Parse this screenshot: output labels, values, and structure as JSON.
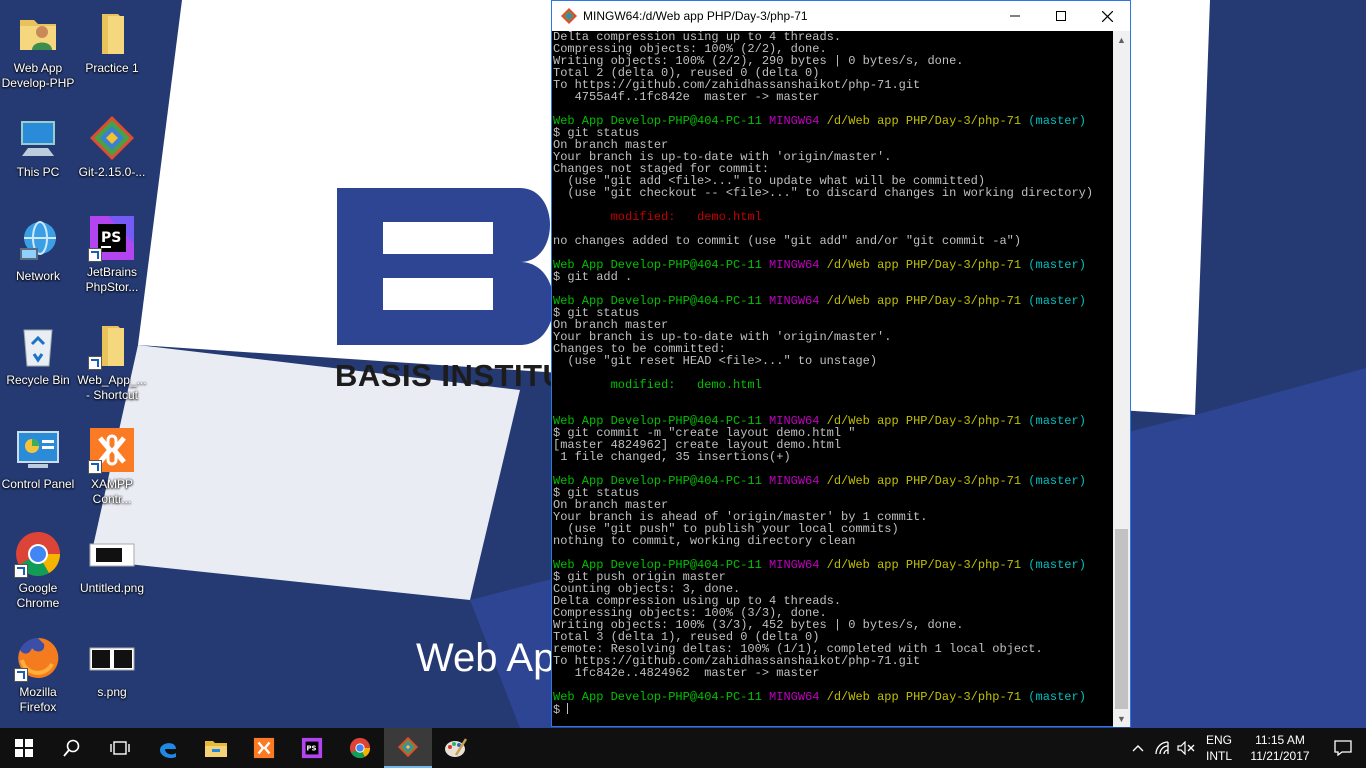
{
  "wallpaper": {
    "brand_text": "BASIS INSTITUT",
    "tagline": "Web Ap"
  },
  "desktop_icons": [
    {
      "id": "web-app-develop-php",
      "label": "Web App Develop-PHP",
      "icon": "user-folder-icon"
    },
    {
      "id": "practice-1",
      "label": "Practice 1",
      "icon": "folder-icon"
    },
    {
      "id": "this-pc",
      "label": "This PC",
      "icon": "computer-icon"
    },
    {
      "id": "git-installer",
      "label": "Git-2.15.0-...",
      "icon": "git-icon"
    },
    {
      "id": "network",
      "label": "Network",
      "icon": "network-icon"
    },
    {
      "id": "phpstorm",
      "label": "JetBrains PhpStor...",
      "icon": "phpstorm-icon"
    },
    {
      "id": "recycle-bin",
      "label": "Recycle Bin",
      "icon": "recycle-bin-icon"
    },
    {
      "id": "web-app-shortcut",
      "label": "Web_App_... - Shortcut",
      "icon": "folder-shortcut-icon"
    },
    {
      "id": "control-panel",
      "label": "Control Panel",
      "icon": "control-panel-icon"
    },
    {
      "id": "xampp",
      "label": "XAMPP Contr...",
      "icon": "xampp-icon"
    },
    {
      "id": "google-chrome",
      "label": "Google Chrome",
      "icon": "chrome-icon"
    },
    {
      "id": "untitled-png",
      "label": "Untitled.png",
      "icon": "image-file-icon"
    },
    {
      "id": "mozilla-firefox",
      "label": "Mozilla Firefox",
      "icon": "firefox-icon"
    },
    {
      "id": "s-png",
      "label": "s.png",
      "icon": "image-file-icon"
    }
  ],
  "terminal": {
    "title": "MINGW64:/d/Web app PHP/Day-3/php-71",
    "minimize_label": "—",
    "maximize_label": "☐",
    "close_label": "✕",
    "lines": [
      [
        {
          "t": "Delta compression using up to 4 threads."
        }
      ],
      [
        {
          "t": "Compressing objects: 100% (2/2), done."
        }
      ],
      [
        {
          "t": "Writing objects: 100% (2/2), 290 bytes | 0 bytes/s, done."
        }
      ],
      [
        {
          "t": "Total 2 (delta 0), reused 0 (delta 0)"
        }
      ],
      [
        {
          "t": "To https://github.com/zahidhassanshaikot/php-71.git"
        }
      ],
      [
        {
          "t": "   4755a4f..1fc842e  master -> master"
        }
      ],
      [
        {
          "t": ""
        }
      ],
      [
        {
          "t": "Web App Develop-PHP@404-PC-11 ",
          "c": "green"
        },
        {
          "t": "MINGW64 ",
          "c": "magenta"
        },
        {
          "t": "/d/Web app PHP/Day-3/php-71 ",
          "c": "yellow"
        },
        {
          "t": "(master)",
          "c": "cyan"
        }
      ],
      [
        {
          "t": "$ git status"
        }
      ],
      [
        {
          "t": "On branch master"
        }
      ],
      [
        {
          "t": "Your branch is up-to-date with 'origin/master'."
        }
      ],
      [
        {
          "t": "Changes not staged for commit:"
        }
      ],
      [
        {
          "t": "  (use \"git add <file>...\" to update what will be committed)"
        }
      ],
      [
        {
          "t": "  (use \"git checkout -- <file>...\" to discard changes in working directory)"
        }
      ],
      [
        {
          "t": ""
        }
      ],
      [
        {
          "t": "        modified:   demo.html",
          "c": "red"
        }
      ],
      [
        {
          "t": ""
        }
      ],
      [
        {
          "t": "no changes added to commit (use \"git add\" and/or \"git commit -a\")"
        }
      ],
      [
        {
          "t": ""
        }
      ],
      [
        {
          "t": "Web App Develop-PHP@404-PC-11 ",
          "c": "green"
        },
        {
          "t": "MINGW64 ",
          "c": "magenta"
        },
        {
          "t": "/d/Web app PHP/Day-3/php-71 ",
          "c": "yellow"
        },
        {
          "t": "(master)",
          "c": "cyan"
        }
      ],
      [
        {
          "t": "$ git add ."
        }
      ],
      [
        {
          "t": ""
        }
      ],
      [
        {
          "t": "Web App Develop-PHP@404-PC-11 ",
          "c": "green"
        },
        {
          "t": "MINGW64 ",
          "c": "magenta"
        },
        {
          "t": "/d/Web app PHP/Day-3/php-71 ",
          "c": "yellow"
        },
        {
          "t": "(master)",
          "c": "cyan"
        }
      ],
      [
        {
          "t": "$ git status"
        }
      ],
      [
        {
          "t": "On branch master"
        }
      ],
      [
        {
          "t": "Your branch is up-to-date with 'origin/master'."
        }
      ],
      [
        {
          "t": "Changes to be committed:"
        }
      ],
      [
        {
          "t": "  (use \"git reset HEAD <file>...\" to unstage)"
        }
      ],
      [
        {
          "t": ""
        }
      ],
      [
        {
          "t": "        modified:   demo.html",
          "c": "lgreen"
        }
      ],
      [
        {
          "t": ""
        }
      ],
      [
        {
          "t": ""
        }
      ],
      [
        {
          "t": "Web App Develop-PHP@404-PC-11 ",
          "c": "green"
        },
        {
          "t": "MINGW64 ",
          "c": "magenta"
        },
        {
          "t": "/d/Web app PHP/Day-3/php-71 ",
          "c": "yellow"
        },
        {
          "t": "(master)",
          "c": "cyan"
        }
      ],
      [
        {
          "t": "$ git commit -m \"create layout demo.html \""
        }
      ],
      [
        {
          "t": "[master 4824962] create layout demo.html"
        }
      ],
      [
        {
          "t": " 1 file changed, 35 insertions(+)"
        }
      ],
      [
        {
          "t": ""
        }
      ],
      [
        {
          "t": "Web App Develop-PHP@404-PC-11 ",
          "c": "green"
        },
        {
          "t": "MINGW64 ",
          "c": "magenta"
        },
        {
          "t": "/d/Web app PHP/Day-3/php-71 ",
          "c": "yellow"
        },
        {
          "t": "(master)",
          "c": "cyan"
        }
      ],
      [
        {
          "t": "$ git status"
        }
      ],
      [
        {
          "t": "On branch master"
        }
      ],
      [
        {
          "t": "Your branch is ahead of 'origin/master' by 1 commit."
        }
      ],
      [
        {
          "t": "  (use \"git push\" to publish your local commits)"
        }
      ],
      [
        {
          "t": "nothing to commit, working directory clean"
        }
      ],
      [
        {
          "t": ""
        }
      ],
      [
        {
          "t": "Web App Develop-PHP@404-PC-11 ",
          "c": "green"
        },
        {
          "t": "MINGW64 ",
          "c": "magenta"
        },
        {
          "t": "/d/Web app PHP/Day-3/php-71 ",
          "c": "yellow"
        },
        {
          "t": "(master)",
          "c": "cyan"
        }
      ],
      [
        {
          "t": "$ git push origin master"
        }
      ],
      [
        {
          "t": "Counting objects: 3, done."
        }
      ],
      [
        {
          "t": "Delta compression using up to 4 threads."
        }
      ],
      [
        {
          "t": "Compressing objects: 100% (3/3), done."
        }
      ],
      [
        {
          "t": "Writing objects: 100% (3/3), 452 bytes | 0 bytes/s, done."
        }
      ],
      [
        {
          "t": "Total 3 (delta 1), reused 0 (delta 0)"
        }
      ],
      [
        {
          "t": "remote: Resolving deltas: 100% (1/1), completed with 1 local object."
        }
      ],
      [
        {
          "t": "To https://github.com/zahidhassanshaikot/php-71.git"
        }
      ],
      [
        {
          "t": "   1fc842e..4824962  master -> master"
        }
      ],
      [
        {
          "t": ""
        }
      ],
      [
        {
          "t": "Web App Develop-PHP@404-PC-11 ",
          "c": "green"
        },
        {
          "t": "MINGW64 ",
          "c": "magenta"
        },
        {
          "t": "/d/Web app PHP/Day-3/php-71 ",
          "c": "yellow"
        },
        {
          "t": "(master)",
          "c": "cyan"
        }
      ],
      [
        {
          "t": "$ "
        }
      ]
    ]
  },
  "taskbar": {
    "items": [
      {
        "id": "start",
        "icon": "windows-start-icon",
        "active": false
      },
      {
        "id": "search",
        "icon": "search-icon",
        "active": false
      },
      {
        "id": "task-view",
        "icon": "task-view-icon",
        "active": false
      },
      {
        "id": "edge",
        "icon": "edge-icon",
        "active": false
      },
      {
        "id": "file-explorer",
        "icon": "file-explorer-icon",
        "active": false
      },
      {
        "id": "xampp",
        "icon": "xampp-icon",
        "active": false
      },
      {
        "id": "phpstorm",
        "icon": "phpstorm-icon",
        "active": false
      },
      {
        "id": "chrome",
        "icon": "chrome-icon",
        "active": false
      },
      {
        "id": "git-bash",
        "icon": "git-icon",
        "active": true
      },
      {
        "id": "paint",
        "icon": "paint-icon",
        "active": false
      }
    ],
    "tray": {
      "lang_line1": "ENG",
      "lang_line2": "INTL",
      "time": "11:15 AM",
      "date": "11/21/2017"
    }
  },
  "colors": {
    "terminal_green": "#00c000",
    "terminal_magenta": "#c000c0",
    "terminal_yellow": "#c0c000",
    "terminal_cyan": "#00c0c0",
    "terminal_red": "#c00000",
    "wallpaper_blue": "#2d4592"
  }
}
